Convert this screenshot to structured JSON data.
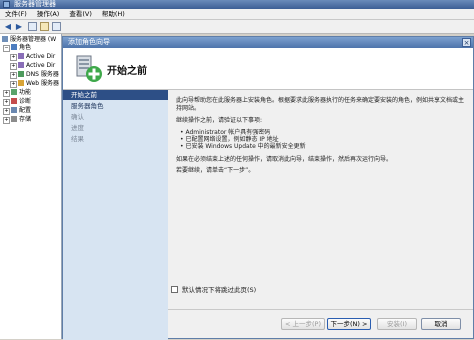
{
  "window": {
    "title": "服务器管理器"
  },
  "menu": [
    "文件(F)",
    "操作(A)",
    "查看(V)",
    "帮助(H)"
  ],
  "tree": [
    {
      "label": "服务器管理器 (W",
      "icon": "server-manager-icon"
    },
    {
      "label": "角色",
      "icon": "roles-icon"
    },
    {
      "label": "Active Dir",
      "icon": "ad-icon"
    },
    {
      "label": "Active Dir",
      "icon": "ad-icon"
    },
    {
      "label": "DNS 服务器",
      "icon": "dns-icon"
    },
    {
      "label": "Web 服务器",
      "icon": "web-icon"
    },
    {
      "label": "功能",
      "icon": "features-icon"
    },
    {
      "label": "诊断",
      "icon": "diagnostics-icon"
    },
    {
      "label": "配置",
      "icon": "configuration-icon"
    },
    {
      "label": "存储",
      "icon": "storage-icon"
    }
  ],
  "wizard": {
    "title": "添加角色向导",
    "heading": "开始之前",
    "nav": [
      {
        "label": "开始之前",
        "state": "active"
      },
      {
        "label": "服务器角色",
        "state": "normal"
      },
      {
        "label": "确认",
        "state": "disabled"
      },
      {
        "label": "进度",
        "state": "disabled"
      },
      {
        "label": "结果",
        "state": "disabled"
      }
    ],
    "intro": "此向导帮助您在此服务器上安装角色。根据要求此服务器执行的任务来确定要安装的角色，例如共享文档或主持网站。",
    "verify_heading": "继续操作之前，请验证以下事项:",
    "bullets": [
      "• Administrator 帐户具有强密码",
      "• 已配置网络设置，例如静态 IP 地址",
      "• 已安装 Windows Update 中的最新安全更新"
    ],
    "if_not_done": "如果在必须结束上述的任何操作，请取消此向导，结束操作，然后再次运行向导。",
    "continue_hint": "若要继续，请单击“下一步”。",
    "skip_checkbox": "默认情况下将跳过此页(S)",
    "buttons": {
      "back": "< 上一步(P)",
      "next": "下一步(N) >",
      "install": "安装(I)",
      "cancel": "取消"
    }
  },
  "colors": {
    "title_blue": "#4e74ab",
    "nav_bg": "#d7e4f2",
    "nav_active": "#2d4f86"
  }
}
